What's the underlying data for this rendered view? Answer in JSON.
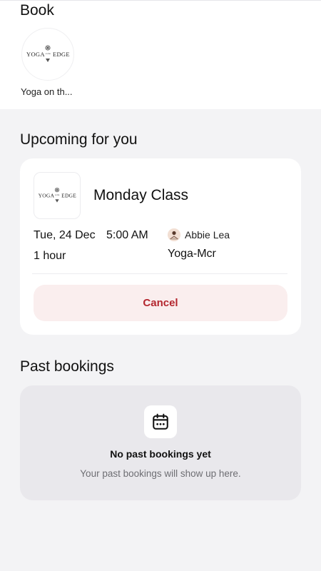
{
  "book_section": {
    "title": "Book",
    "studio": {
      "logo_text": "YOGA EDGE",
      "name": "Yoga on th..."
    }
  },
  "upcoming": {
    "heading": "Upcoming for you",
    "booking": {
      "class_name": "Monday Class",
      "date": "Tue, 24 Dec",
      "time": "5:00 AM",
      "duration": "1 hour",
      "instructor": "Abbie Lea",
      "location": "Yoga-Mcr",
      "cancel_label": "Cancel"
    }
  },
  "past": {
    "heading": "Past bookings",
    "empty_title": "No past bookings yet",
    "empty_subtitle": "Your past bookings will show up here.",
    "icon": "calendar-icon"
  },
  "colors": {
    "background": "#f3f3f5",
    "card": "#ffffff",
    "cancel_bg": "#faeeee",
    "cancel_text": "#b3262e",
    "empty_card": "#e9e8ec"
  }
}
